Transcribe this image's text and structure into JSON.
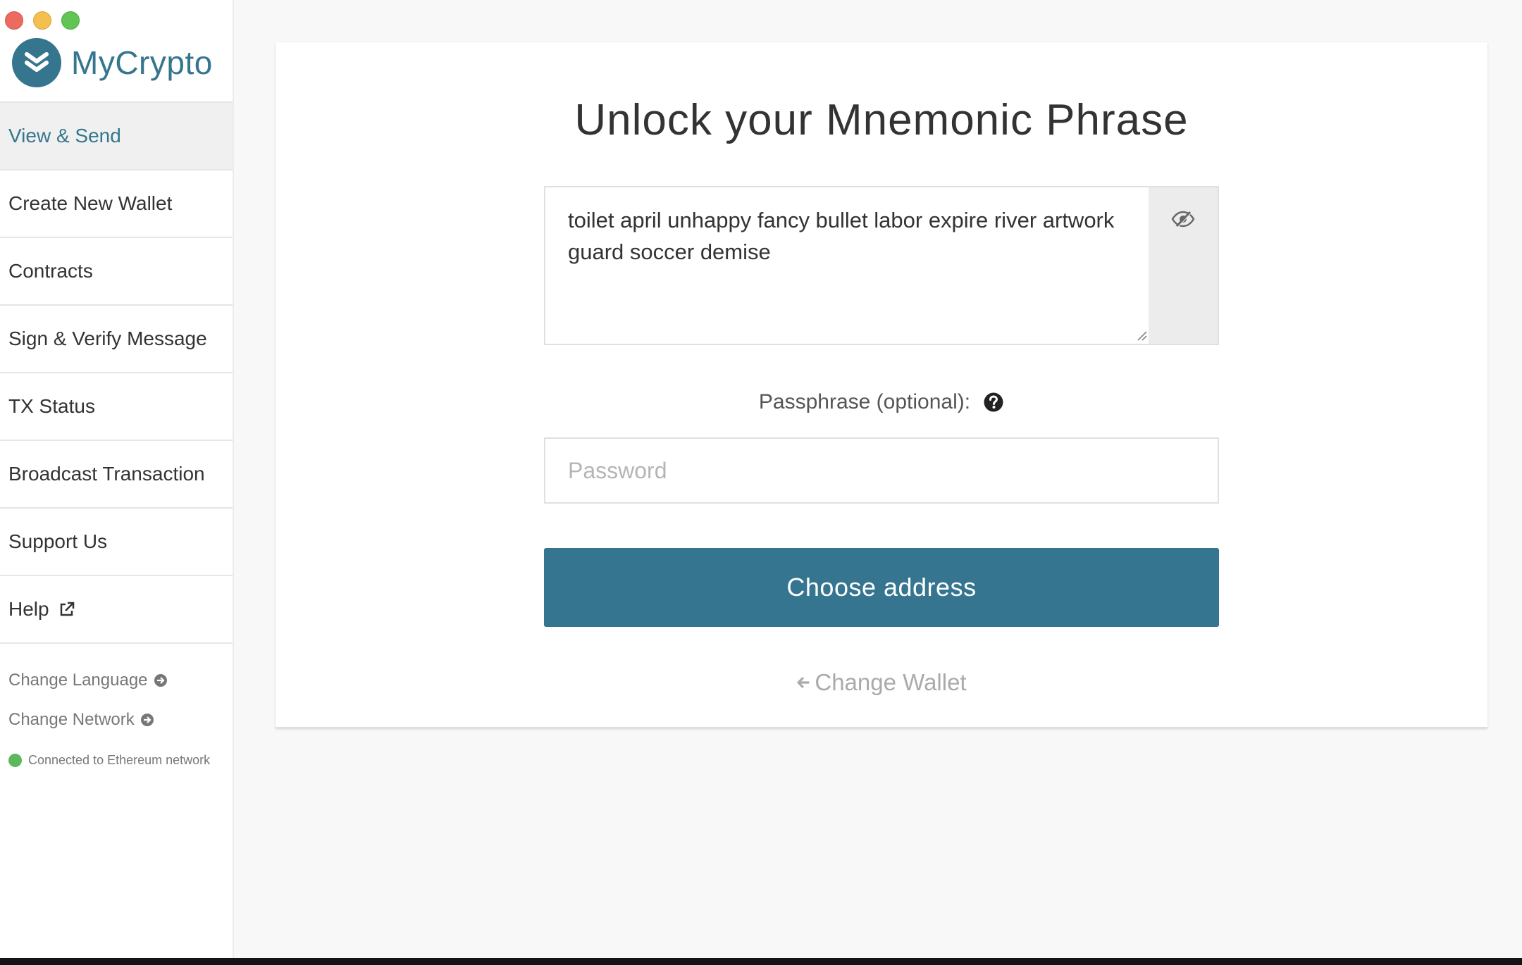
{
  "sidebar": {
    "brand": "MyCrypto",
    "nav": [
      {
        "label": "View & Send",
        "active": true
      },
      {
        "label": "Create New Wallet"
      },
      {
        "label": "Contracts"
      },
      {
        "label": "Sign & Verify Message"
      },
      {
        "label": "TX Status"
      },
      {
        "label": "Broadcast Transaction"
      },
      {
        "label": "Support Us"
      },
      {
        "label": "Help",
        "icon": "external-link-icon"
      }
    ],
    "change_language": "Change Language",
    "change_network": "Change Network",
    "status_text": "Connected to Ethereum network",
    "status_color": "#5cb85c"
  },
  "main": {
    "title": "Unlock your Mnemonic Phrase",
    "mnemonic_value": "toilet april unhappy fancy bullet labor expire river artwork guard soccer demise",
    "passphrase_label": "Passphrase (optional):",
    "password_placeholder": "Password",
    "choose_button": "Choose address",
    "change_wallet": "Change Wallet"
  },
  "colors": {
    "accent": "#357590"
  }
}
